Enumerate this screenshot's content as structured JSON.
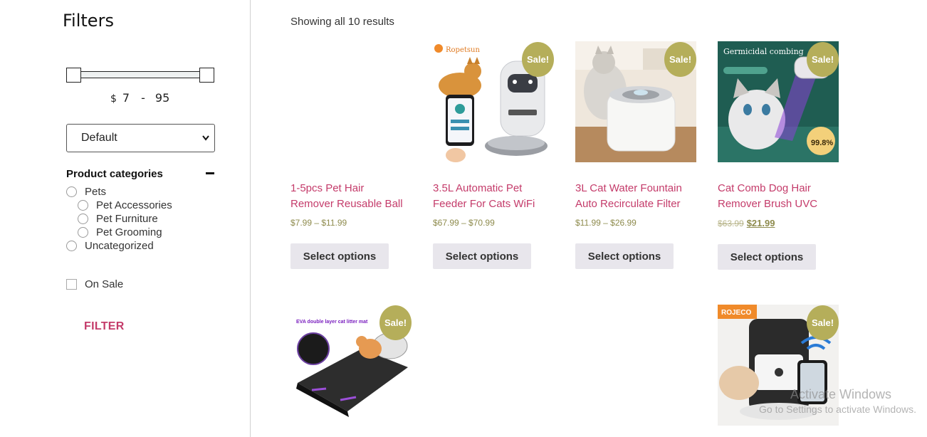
{
  "sidebar": {
    "title": "Filters",
    "price": {
      "currency": "$",
      "min": "7",
      "separator": "-",
      "max": "95"
    },
    "sort": {
      "selected": "Default"
    },
    "categories": {
      "heading": "Product categories",
      "items": [
        {
          "label": "Pets"
        },
        {
          "label": "Pet Accessories"
        },
        {
          "label": "Pet Furniture"
        },
        {
          "label": "Pet Grooming"
        },
        {
          "label": "Uncategorized"
        }
      ]
    },
    "on_sale_label": "On Sale",
    "filter_button": "FILTER"
  },
  "main": {
    "results_text": "Showing all 10 results",
    "sale_badge": "Sale!",
    "products": [
      {
        "title_line1": "1-5pcs Pet Hair",
        "title_line2": "Remover Reusable Ball",
        "price": "$7.99 – $11.99",
        "button": "Select options"
      },
      {
        "title_line1": "3.5L Automatic Pet",
        "title_line2": "Feeder For Cats WiFi",
        "price": "$67.99 – $70.99",
        "button": "Select options",
        "image_brand": "Ropetsun"
      },
      {
        "title_line1": "3L Cat Water Fountain",
        "title_line2": "Auto Recirculate Filter",
        "price": "$11.99 – $26.99",
        "button": "Select options"
      },
      {
        "title_line1": "Cat Comb Dog Hair",
        "title_line2": "Remover Brush UVC",
        "old_price": "$63.99",
        "new_price": "$21.99",
        "button": "Select options",
        "image_caption": "Germicidal combing",
        "image_badge": "99.8%"
      },
      {
        "image_caption": "EVA double layer cat litter mat"
      },
      {
        "image_brand": "ROJECO"
      }
    ]
  },
  "watermark": {
    "line1": "Activate Windows",
    "line2": "Go to Settings to activate Windows."
  },
  "colors": {
    "accent": "#c43b6a",
    "sale_badge": "#b5ae5a",
    "price": "#8e8b4d",
    "button_bg": "#e8e6ec"
  }
}
